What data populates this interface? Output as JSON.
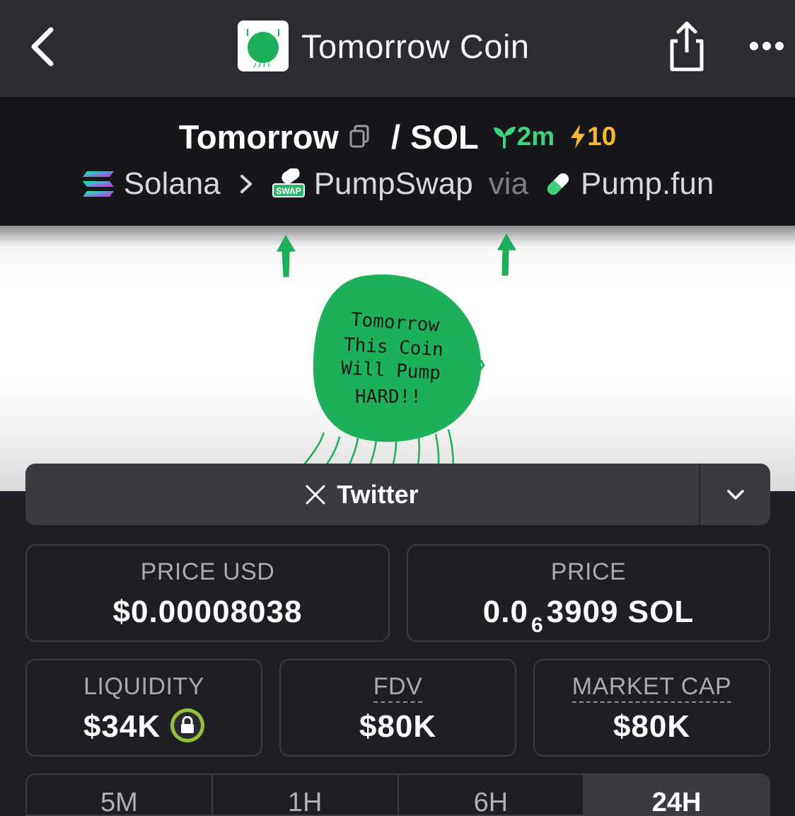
{
  "header": {
    "back_icon": "chevron-left-icon",
    "title": "Tomorrow Coin",
    "share_icon": "share-icon",
    "more_icon": "more-horizontal-icon"
  },
  "pair": {
    "base": "Tomorrow",
    "separator": "/",
    "quote": "SOL",
    "age": "2m",
    "boosts": "10",
    "chain": "Solana",
    "dex": "PumpSwap",
    "via_label": "via",
    "launchpad": "Pump.fun"
  },
  "banner": {
    "coin_text_line1": "Tomorrow",
    "coin_text_line2": "This Coin",
    "coin_text_line3": "Will Pump",
    "coin_text_line4": "HARD!!",
    "coin_color": "#1db05a"
  },
  "social": {
    "label": "Twitter"
  },
  "stats": {
    "price_usd_label": "PRICE USD",
    "price_usd": "$0.00008038",
    "price_label": "PRICE",
    "price_sol_prefix": "0.0",
    "price_sol_zeros": "6",
    "price_sol_digits": "3909",
    "price_sol_unit": "SOL",
    "liquidity_label": "LIQUIDITY",
    "liquidity": "$34K",
    "fdv_label": "FDV",
    "fdv": "$80K",
    "market_cap_label": "MARKET CAP",
    "market_cap": "$80K"
  },
  "timeframes": [
    "5M",
    "1H",
    "6H",
    "24H"
  ],
  "colors": {
    "age_green": "#3fd17f",
    "boost_yellow": "#f5b82e",
    "lock_badge": "#94c13a"
  }
}
